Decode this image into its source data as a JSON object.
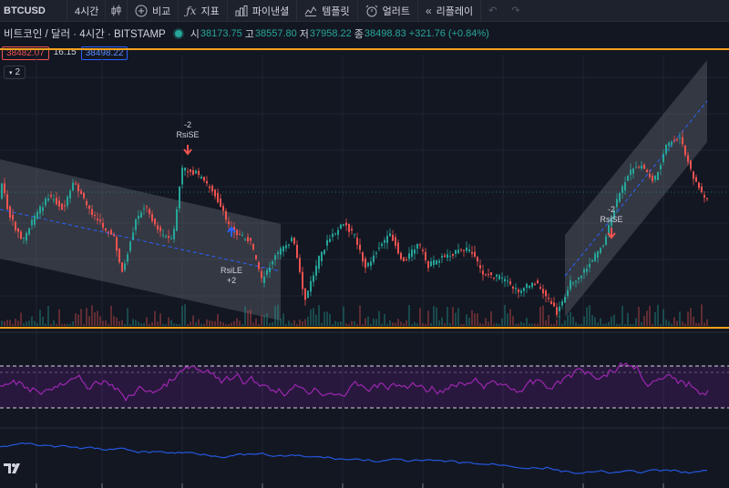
{
  "toolbar": {
    "symbol": "BTCUSD",
    "interval": "4시간",
    "compare_label": "비교",
    "indicators_label": "지표",
    "financials_label": "파이낸셜",
    "templates_label": "템플릿",
    "alert_label": "얼러트",
    "replay_label": "리플레이",
    "icons": [
      "candles-icon",
      "plus-circle-icon",
      "fx-icon",
      "bars-icon",
      "template-icon",
      "alarm-icon",
      "rewind-icon",
      "undo-icon",
      "redo-icon"
    ]
  },
  "legend": {
    "title": "비트코인 / 달러 · 4시간 · BITSTAMP",
    "open_label": "시",
    "open": "38173.75",
    "high_label": "고",
    "high": "38557.80",
    "low_label": "저",
    "low": "37958.22",
    "close_label": "종",
    "close": "38498.83",
    "change": "+321.76 (+0.84%)"
  },
  "price_badges": {
    "bid": "38482.07",
    "spread": "16.15",
    "ask": "38498.22"
  },
  "collapse_count": "2",
  "annotations": {
    "short_entry_qty": "-2",
    "short_entry_label": "RsiSE",
    "long_entry_label": "RsiLE",
    "long_entry_qty": "+2",
    "short_entry2_qty": "-2",
    "short_entry2_label": "RsiSE"
  },
  "colors": {
    "background": "#131722",
    "up": "#26a69a",
    "down": "#ef5350",
    "orange_line": "#f7a21b",
    "rsi": "#9c27b0",
    "rsi_band": "#4a1a5e",
    "channel": "#787b86"
  },
  "chart_data": {
    "type": "candlestick",
    "symbol": "BTCUSD",
    "ohlc_last": {
      "open": 38173.75,
      "high": 38557.8,
      "low": 37958.22,
      "close": 38498.83
    },
    "change": 321.76,
    "change_pct": 0.84,
    "panes": [
      "price",
      "rsi",
      "lower-indicator"
    ]
  }
}
